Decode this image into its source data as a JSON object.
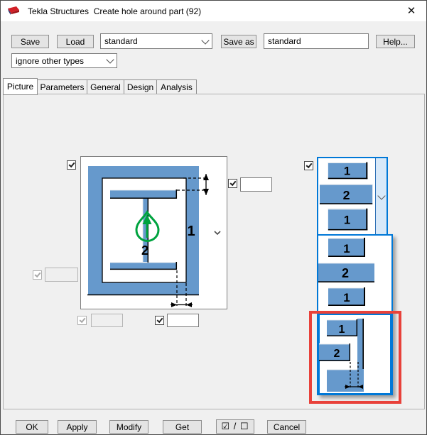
{
  "window": {
    "title": "Tekla Structures  Create hole around part (92)",
    "close_glyph": "✕"
  },
  "toolbar": {
    "save_label": "Save",
    "load_label": "Load",
    "settings_combo_value": "standard",
    "save_as_label": "Save as",
    "settings_name_value": "standard",
    "settings_name_placeholder": "",
    "help_label": "Help...",
    "filter_combo_value": "ignore other types"
  },
  "tabs": [
    {
      "label": "Picture",
      "active": true
    },
    {
      "label": "Parameters",
      "active": false
    },
    {
      "label": "General",
      "active": false
    },
    {
      "label": "Design",
      "active": false
    },
    {
      "label": "Analysis",
      "active": false
    }
  ],
  "diagram": {
    "part_label": "1",
    "hole_label": "2"
  },
  "fields": {
    "top_offset_value": "",
    "left_offset_value": "",
    "bottom_left_value": "",
    "bottom_right_value": ""
  },
  "footer": {
    "ok_label": "OK",
    "apply_label": "Apply",
    "modify_label": "Modify",
    "get_label": "Get",
    "toggle_label": "☑ / ☐",
    "cancel_label": "Cancel"
  },
  "colors": {
    "steel_blue": "#6699cc",
    "selection_blue": "#0078d7",
    "annotation_red": "#e8413a",
    "arrow_green": "#00a33f",
    "titlebar_bg": "#ffffff",
    "dialog_bg": "#f0f0f0"
  }
}
